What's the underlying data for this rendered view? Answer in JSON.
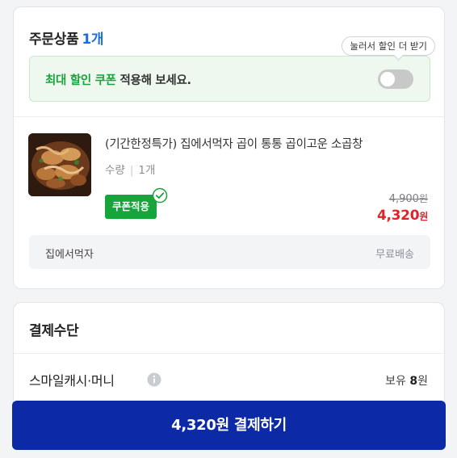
{
  "order": {
    "title": "주문상품",
    "count": "1개",
    "tooltip": "눌러서 할인 더 받기",
    "coupon_banner": {
      "highlight": "최대 할인 쿠폰",
      "text": "적용해 보세요.",
      "toggle_on": false
    },
    "product": {
      "name": "(기간한정특가) 집에서먹자 곱이 통통 곱이고운 소곱창",
      "qty_label": "수량",
      "qty_value": "1개",
      "coupon_badge": "쿠폰적용",
      "original_price": "4,900",
      "final_price": "4,320",
      "currency": "원"
    },
    "seller": {
      "name": "집에서먹자",
      "shipping": "무료배송"
    }
  },
  "payment": {
    "title": "결제수단",
    "method_label": "스마일캐시·머니",
    "balance_label": "보유",
    "balance_value": "8",
    "balance_unit": "원"
  },
  "pay_button": {
    "amount": "4,320원",
    "label": "결제하기"
  },
  "colors": {
    "accent_blue": "#1a6fdc",
    "coupon_green": "#17a43b",
    "price_red": "#e0232a",
    "pay_button": "#0c2aa6"
  }
}
